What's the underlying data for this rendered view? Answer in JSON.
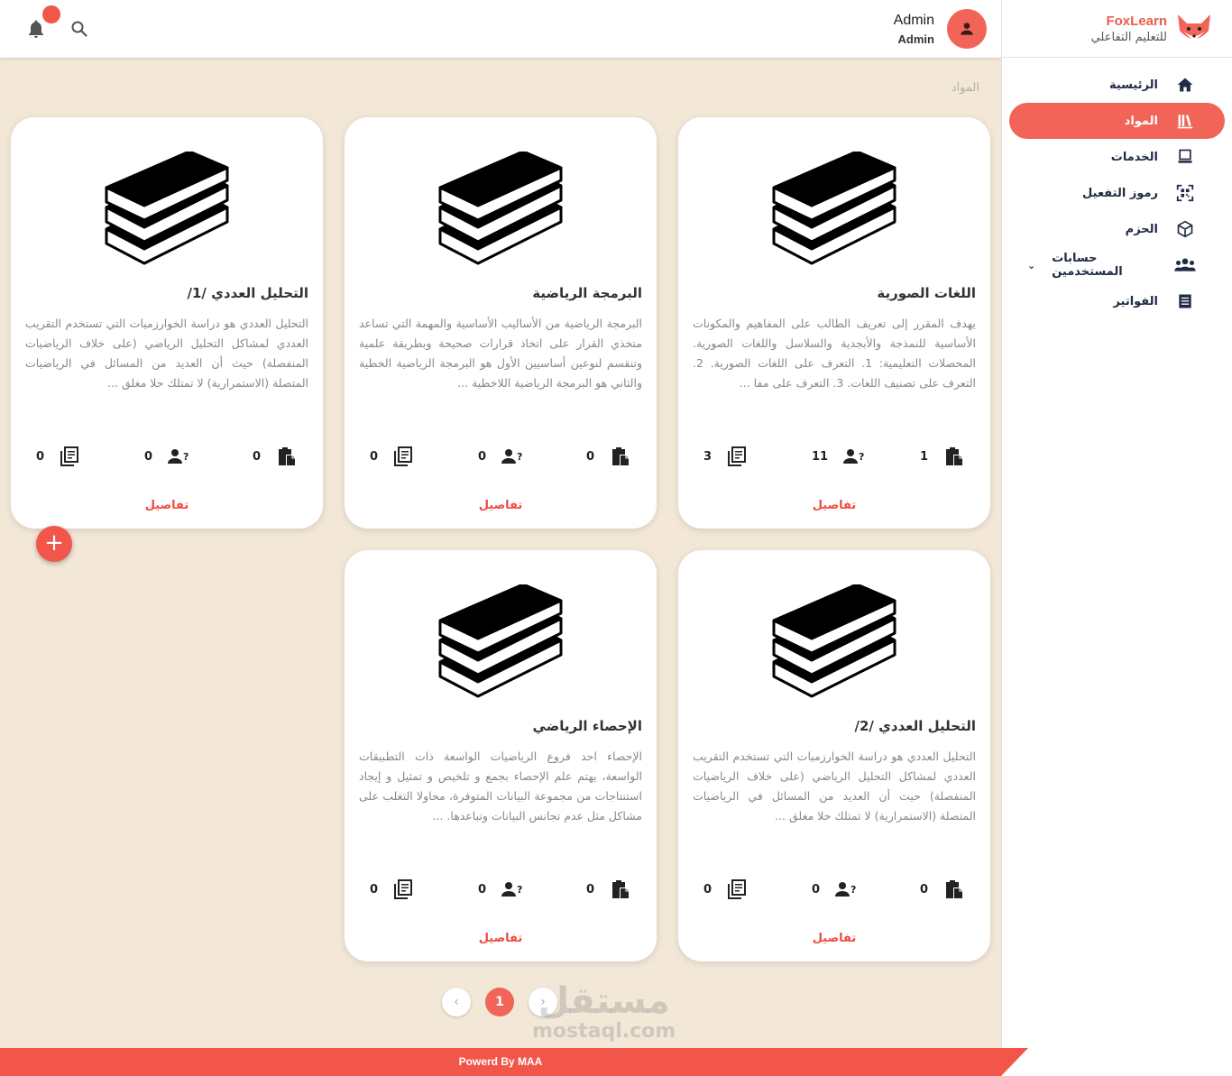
{
  "brand": {
    "name": "FoxLearn",
    "subtitle": "للتعليم التفاعلي"
  },
  "header": {
    "user_name": "Admin",
    "user_role": "Admin"
  },
  "breadcrumb": "المواد",
  "sidebar": {
    "items": [
      {
        "label": "الرئيسية",
        "icon": "home-icon",
        "active": false
      },
      {
        "label": "المواد",
        "icon": "books-icon",
        "active": true
      },
      {
        "label": "الخدمات",
        "icon": "laptop-icon",
        "active": false
      },
      {
        "label": "رموز التفعيل",
        "icon": "qr-code-icon",
        "active": false
      },
      {
        "label": "الحزم",
        "icon": "package-icon",
        "active": false
      },
      {
        "label": "حسابات المستخدمين",
        "icon": "users-icon",
        "active": false
      },
      {
        "label": "الفواتير",
        "icon": "invoice-icon",
        "active": false
      }
    ]
  },
  "cards": [
    {
      "title": "اللغات الصورية",
      "description": "يهدف المقرر إلى تعريف الطالب على المفاهيم والمكونات الأساسية للنمذجة والأبجدية والسلاسل واللغات الصورية. المحصلات التعليمية: 1. التعرف على اللغات الصورية. 2. التعرف على تصنيف اللغات. 3. التعرف على مفا ...",
      "stat_clipboard": "1",
      "stat_users": "11",
      "stat_pages": "3",
      "details": "تفاصيل"
    },
    {
      "title": "البرمجة الرياضية",
      "description": "البرمجة الرياضية من الأساليب الأساسية والمهمة التي تساعد متخذي القرار على اتخاذ قرارات صحيحة وبطريقة علمية وتنقسم لنوعين أساسيين الأول هو البرمجة الرياضية الخطية والثاني هو البرمجة الرياضية اللاخطية ...",
      "stat_clipboard": "0",
      "stat_users": "0",
      "stat_pages": "0",
      "details": "تفاصيل"
    },
    {
      "title": "التحليل العددي /1/",
      "description": "التحليل العددي هو دراسة الخوارزميات التي تستخدم التقريب العددي لمشاكل التحليل الرياضي (على خلاف الرياضيات المنفصلة) حيث أن العديد من المسائل في الرياضيات المتصلة (الاستمرارية) لا تمتلك حلا مغلق ...",
      "stat_clipboard": "0",
      "stat_users": "0",
      "stat_pages": "0",
      "details": "تفاصيل"
    },
    {
      "title": "التحليل العددي /2/",
      "description": "التحليل العددي هو دراسة الخوارزميات التي تستخدم التقريب العددي لمشاكل التحليل الرياضي (على خلاف الرياضيات المنفصلة) حيث أن العديد من المسائل في الرياضيات المتصلة (الاستمرارية) لا تمتلك حلا مغلق ...",
      "stat_clipboard": "0",
      "stat_users": "0",
      "stat_pages": "0",
      "details": "تفاصيل"
    },
    {
      "title": "الإحصاء الرياضي",
      "description": "الإحصاء احد فروع الرياضيات الواسعة ذات التطبيقات الواسعة، يهتم علم الإحصاء بجمع و تلخيص و تمثيل و إيجاد استنتاجات من مجموعة البيانات المتوفرة، محاولا التغلب على مشاكل مثل عدم تجانس البيانات وتباعدها. ...",
      "stat_clipboard": "0",
      "stat_users": "0",
      "stat_pages": "0",
      "details": "تفاصيل"
    }
  ],
  "add_button": "+",
  "pagination": {
    "current": "1",
    "prev": "‹",
    "next": "›"
  },
  "watermark": {
    "ar": "مستقل",
    "en": "mostaql.com"
  },
  "footer": "Powerd By MAA",
  "colors": {
    "accent": "#f26457",
    "background": "#f3e7d8"
  }
}
